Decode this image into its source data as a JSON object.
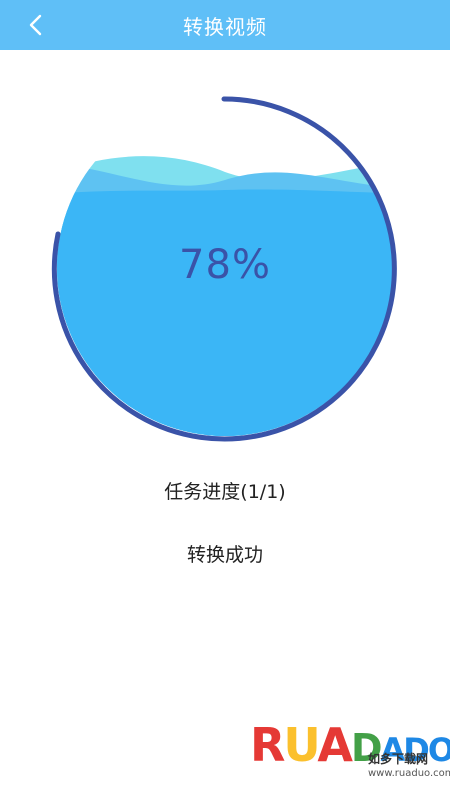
{
  "header": {
    "title": "转换视频",
    "back_icon": "chevron-left-icon"
  },
  "progress": {
    "percent_label": "78%",
    "fraction": 0.78,
    "task_progress": "任务进度(1/1)",
    "status": "转换成功"
  },
  "colors": {
    "header_bg": "#5fbff7",
    "water": "#3bb6f6",
    "wave_light": "#7fe0ef",
    "ring": "#3a53a8"
  },
  "watermark": {
    "brand": "RUANDADO",
    "site_name": "如多下载网",
    "url": "www.ruaduo.com"
  }
}
